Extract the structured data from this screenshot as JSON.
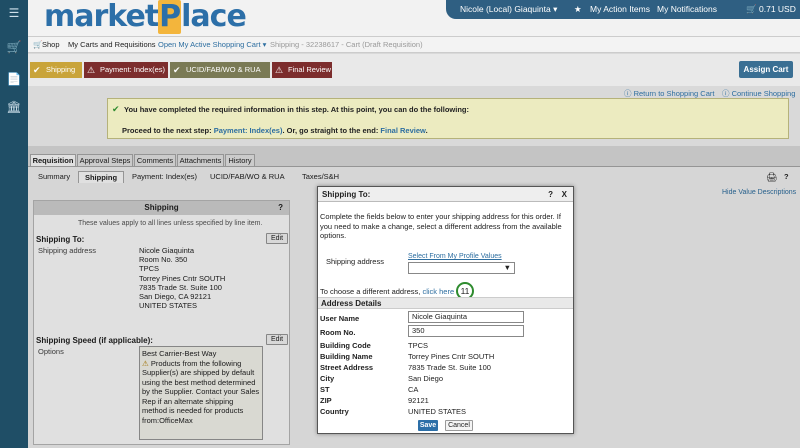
{
  "app": {
    "logo_left": "market",
    "logo_p": "P",
    "logo_right": "lace"
  },
  "userbar": {
    "user": "Nicole (Local) Giaquinta",
    "action_items": "My Action Items",
    "notifications": "My Notifications",
    "cart_total": "0.71 USD"
  },
  "navbar": {
    "shop": "Shop",
    "carts": "My Carts and Requisitions",
    "open_cart": "Open My Active Shopping Cart",
    "breadcrumb": "Shipping - 32238617 - Cart (Draft Requisition)"
  },
  "steps": [
    {
      "label": "Shipping",
      "status": "complete"
    },
    {
      "label": "Payment: Index(es)",
      "status": "warning"
    },
    {
      "label": "UCID/FAB/WO & RUA",
      "status": "complete"
    },
    {
      "label": "Final Review",
      "status": "warning"
    }
  ],
  "assign_cart": "Assign Cart",
  "links": {
    "return": "Return to Shopping Cart",
    "continue": "Continue Shopping"
  },
  "notice": {
    "line1": "You have completed the required information in this step. At this point, you can do the following:",
    "line2_prefix": "Proceed to the next step:",
    "line2_next": "Payment: Index(es)",
    "line2_mid": ". Or, go straight to the end:",
    "line2_end": "Final Review",
    "line2_suffix": "."
  },
  "top_tabs": [
    "Requisition",
    "Approval Steps",
    "Comments",
    "Attachments",
    "History"
  ],
  "sub_tabs": [
    "Summary",
    "Shipping",
    "Payment: Index(es)",
    "UCID/FAB/WO & RUA",
    "Taxes/S&H"
  ],
  "hide_descriptions": "Hide Value Descriptions",
  "shipping_panel": {
    "title": "Shipping",
    "help": "?",
    "note": "These values apply to all lines unless specified by line item.",
    "ship_to_label": "Shipping To:",
    "edit": "Edit",
    "address_label": "Shipping address",
    "address_lines": [
      "Nicole Giaquinta",
      "Room No. 350",
      "TPCS",
      "Torrey Pines Cntr SOUTH",
      "7835 Trade St. Suite 100",
      "San Diego, CA 92121",
      "UNITED STATES"
    ],
    "speed_label": "Shipping Speed (if applicable):",
    "options_label": "Options",
    "speed_value": "Best Carrier-Best Way",
    "speed_note": "Products from the following Supplier(s) are shipped by default using the best method determined by the Supplier. Contact your Sales Rep if an alternate shipping method is needed for products from:OfficeMax"
  },
  "modal": {
    "title": "Shipping To:",
    "help": "?",
    "close": "X",
    "intro": "Complete the fields below to enter your shipping address for this order. If you need to make a change, select a different address from the available options.",
    "addr_label": "Shipping address",
    "profile_link": "Select From My Profile Values",
    "choose_prefix": "To choose a different address,",
    "choose_link": "click here",
    "step_badge": "11",
    "details_title": "Address Details",
    "user_name_label": "User Name",
    "user_name_value": "Nicole Giaquinta",
    "room_label": "Room No.",
    "room_value": "350",
    "fields": [
      {
        "label": "Building Code",
        "value": "TPCS"
      },
      {
        "label": "Building Name",
        "value": "Torrey Pines Cntr SOUTH"
      },
      {
        "label": "Street Address",
        "value": "7835 Trade St. Suite 100"
      },
      {
        "label": "City",
        "value": "San Diego"
      },
      {
        "label": "ST",
        "value": "CA"
      },
      {
        "label": "ZIP",
        "value": "92121"
      },
      {
        "label": "Country",
        "value": "UNITED STATES"
      }
    ],
    "save": "Save",
    "cancel": "Cancel"
  },
  "colors": {
    "brand_blue": "#2c6fa8",
    "brand_orange": "#f3b53c",
    "step_complete": "#c9a43a",
    "step_warning": "#7c2d2d",
    "badge_green": "#2e8b2e"
  }
}
